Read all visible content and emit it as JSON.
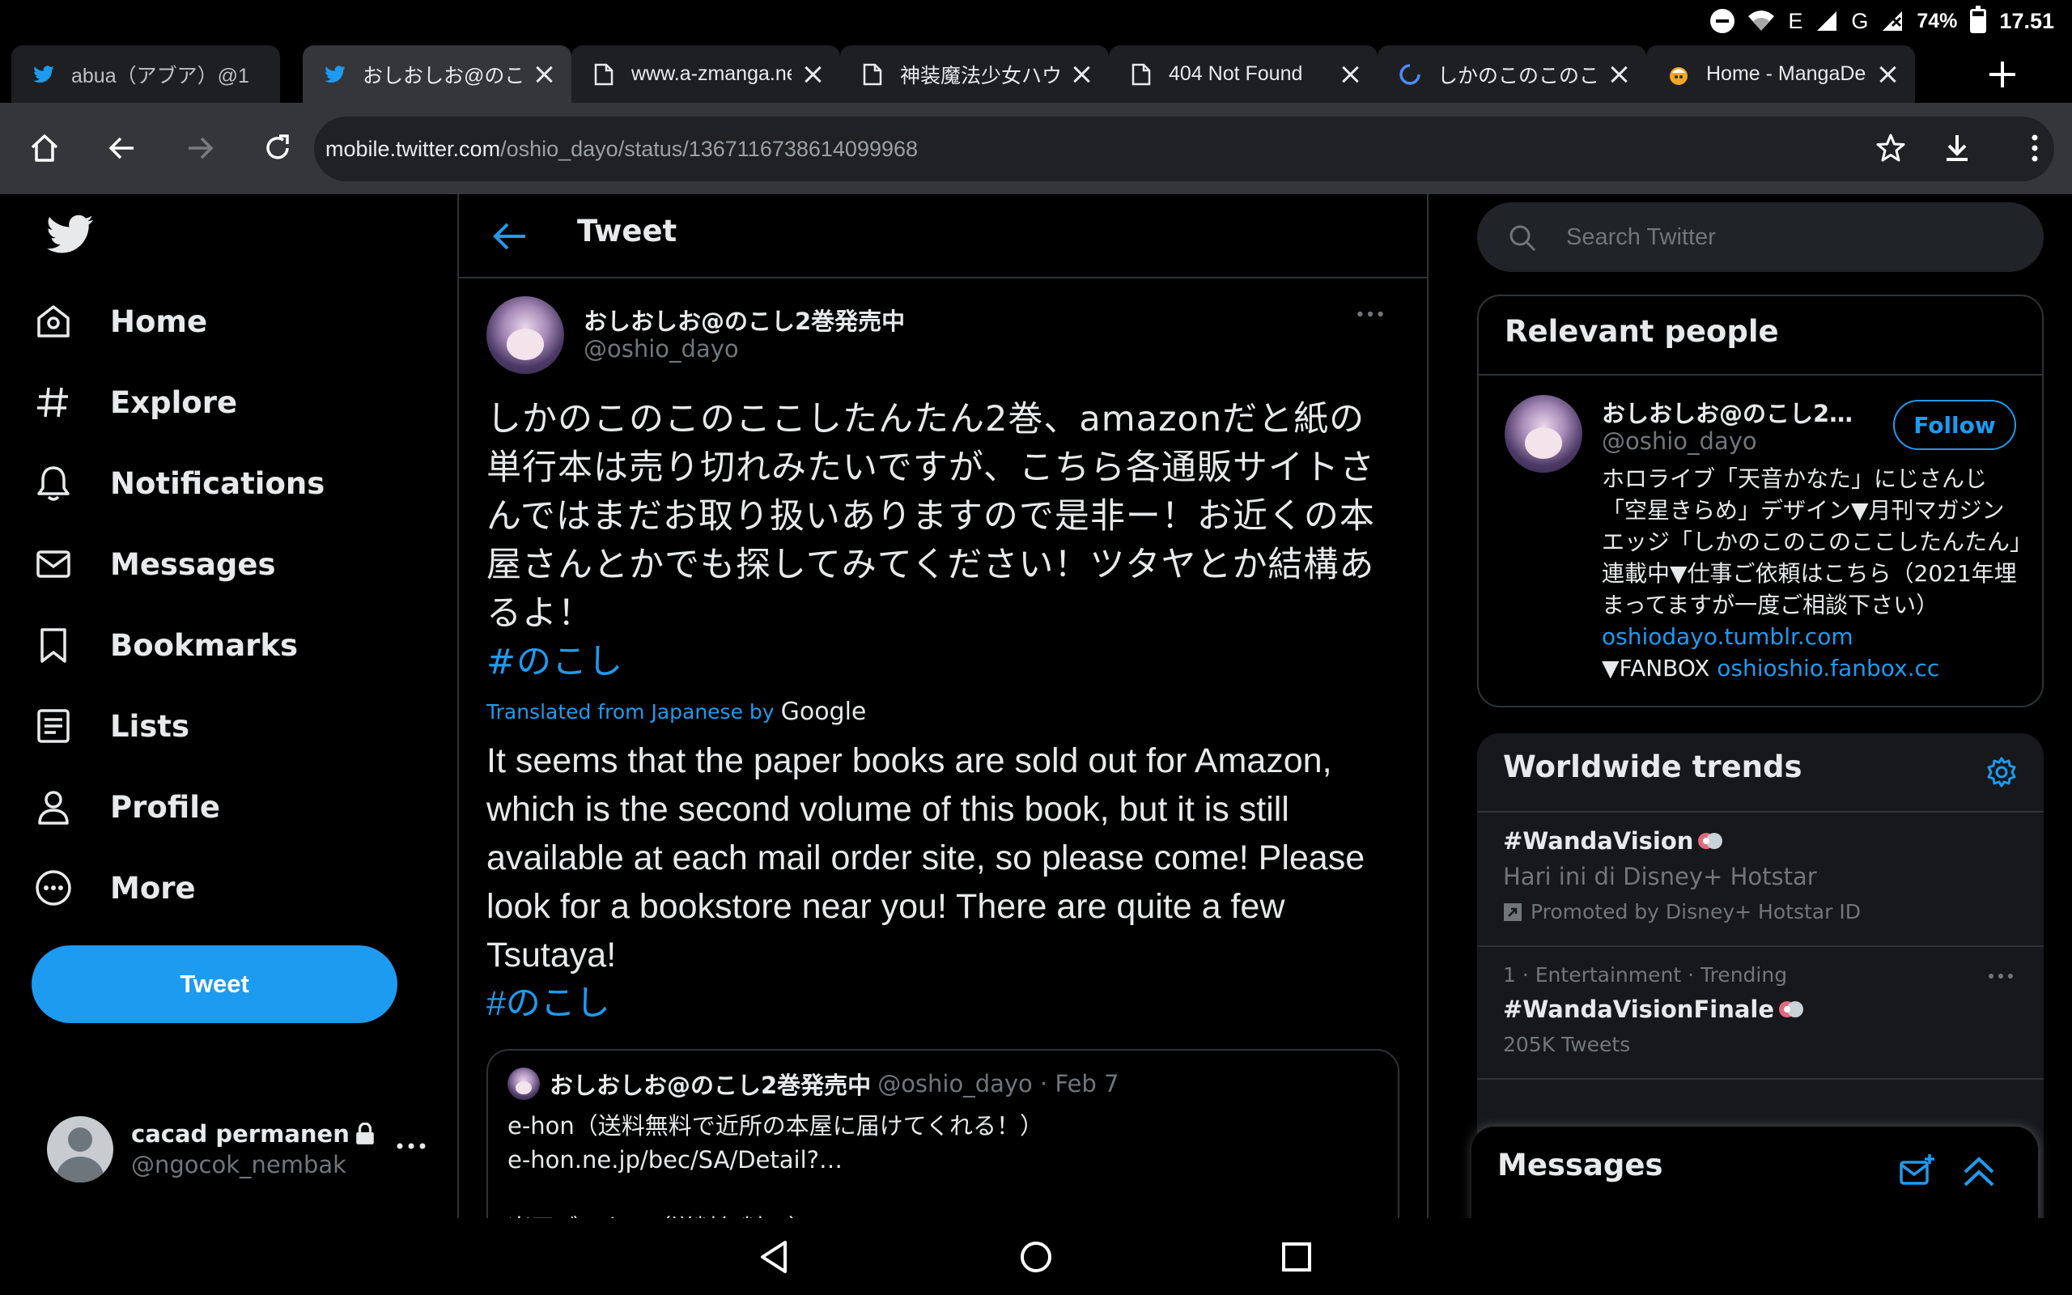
{
  "status_bar": {
    "network_e": "E",
    "network_g": "G",
    "battery_text": "74%",
    "battery_level": 0.74,
    "time": "17.51"
  },
  "tabs": [
    {
      "label": "abua（アブア）@1",
      "icon": "twitter-bird-icon",
      "active": false
    },
    {
      "label": "おしおしお@のこし",
      "icon": "twitter-bird-icon",
      "active": true
    },
    {
      "label": "www.a-zmanga.net",
      "icon": "page-icon",
      "active": false
    },
    {
      "label": "神装魔法少女ハウリ",
      "icon": "page-icon",
      "active": false
    },
    {
      "label": "404 Not Found",
      "icon": "page-icon",
      "active": false
    },
    {
      "label": "しかのこのこのここ",
      "icon": "loading-spinner-icon",
      "active": false
    },
    {
      "label": "Home - MangaDex",
      "icon": "mangadex-icon",
      "active": false
    }
  ],
  "omnibox": {
    "host": "mobile.twitter.com",
    "path": "/oshio_dayo/status/1367116738614099968"
  },
  "nav": {
    "items": [
      {
        "label": "Home",
        "icon": "home-icon"
      },
      {
        "label": "Explore",
        "icon": "hashtag-icon"
      },
      {
        "label": "Notifications",
        "icon": "bell-icon"
      },
      {
        "label": "Messages",
        "icon": "envelope-icon"
      },
      {
        "label": "Bookmarks",
        "icon": "bookmark-icon"
      },
      {
        "label": "Lists",
        "icon": "list-icon"
      },
      {
        "label": "Profile",
        "icon": "person-icon"
      },
      {
        "label": "More",
        "icon": "more-circle-icon"
      }
    ],
    "tweet_button": "Tweet",
    "account": {
      "name": "cacad permanen",
      "handle": "@ngocok_nembak"
    }
  },
  "main": {
    "header_title": "Tweet",
    "author": {
      "name": "おしおしお@のこし2巻発売中",
      "handle": "@oshio_dayo"
    },
    "text_ja": "しかのこのこのここしたんたん2巻、amazonだと紙の単行本は売り切れみたいですが、こちら各通販サイトさんではまだお取り扱いありますので是非ー！お近くの本屋さんとかでも探してみてください！ツタヤとか結構あるよ！",
    "hashtag": "#のこし",
    "translated_label": "Translated from Japanese by",
    "google_word": "Google",
    "text_en": "It seems that the paper books are sold out for Amazon, which is the second volume of this book, but it is still available at each mail order site, so please come! Please look for a bookstore near you! There are quite a few Tsutaya!",
    "quote": {
      "name": "おしおしお@のこし2巻発売中",
      "handle_date": "@oshio_dayo · Feb 7",
      "body": "e-hon（送料無料で近所の本屋に届けてくれる！）\ne-hon.ne.jp/bec/SA/Detail?…\n\n楽天ブックス（送料無料！）"
    }
  },
  "right": {
    "search_placeholder": "Search Twitter",
    "relevant_title": "Relevant people",
    "relevant_person": {
      "name": "おしおしお@のこし2…",
      "handle": "@oshio_dayo",
      "follow_label": "Follow",
      "bio_text": "ホロライブ「天音かなた」にじさんじ「空星きらめ」デザイン▼月刊マガジンエッジ「しかのこのこのここしたんたん」連載中▼仕事ご依頼はこちら（2021年埋まってますが一度ご相談下さい）",
      "bio_link1": "oshiodayo.tumblr.com",
      "bio_fanbox": "▼FANBOX",
      "bio_link2": "oshioshio.fanbox.cc"
    },
    "trends_title": "Worldwide trends",
    "trends": [
      {
        "title": "#WandaVision",
        "subtitle": "Hari ini di Disney+ Hotstar",
        "meta": "Promoted by Disney+ Hotstar ID"
      },
      {
        "meta": "1 · Entertainment · Trending",
        "title": "#WandaVisionFinale",
        "subtitle": "205K Tweets"
      }
    ],
    "messages_title": "Messages"
  },
  "colors": {
    "accent": "#1d9bf0",
    "background": "#000000",
    "border": "#2f3336",
    "muted_text": "#71767b",
    "browser_toolbar": "#35363a"
  }
}
